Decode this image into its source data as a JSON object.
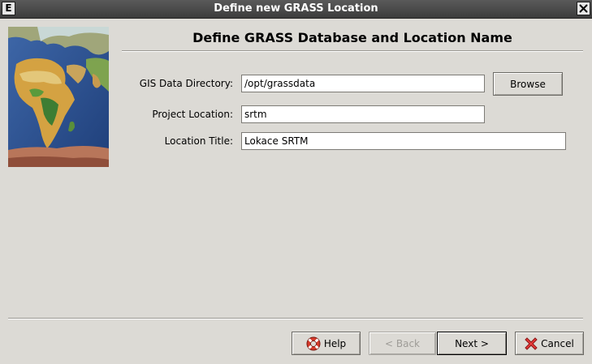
{
  "window": {
    "title": "Define new GRASS Location",
    "menu_glyph": "E",
    "icons": [
      "window-menu-icon",
      "close-icon"
    ]
  },
  "heading": "Define GRASS Database and Location Name",
  "form": {
    "gis_dir_label": "GIS Data Directory:",
    "gis_dir_value": "/opt/grassdata",
    "browse_label": "Browse",
    "project_location_label": "Project Location:",
    "project_location_value": "srtm",
    "location_title_label": "Location Title:",
    "location_title_value": "Lokace SRTM"
  },
  "buttons": {
    "help": "Help",
    "back": "< Back",
    "next": "Next >",
    "cancel": "Cancel"
  },
  "colors": {
    "window_bg": "#dcdad5",
    "titlebar": "#3c3c3c",
    "help_icon": "#d43b2c",
    "cancel_icon": "#d42222"
  }
}
